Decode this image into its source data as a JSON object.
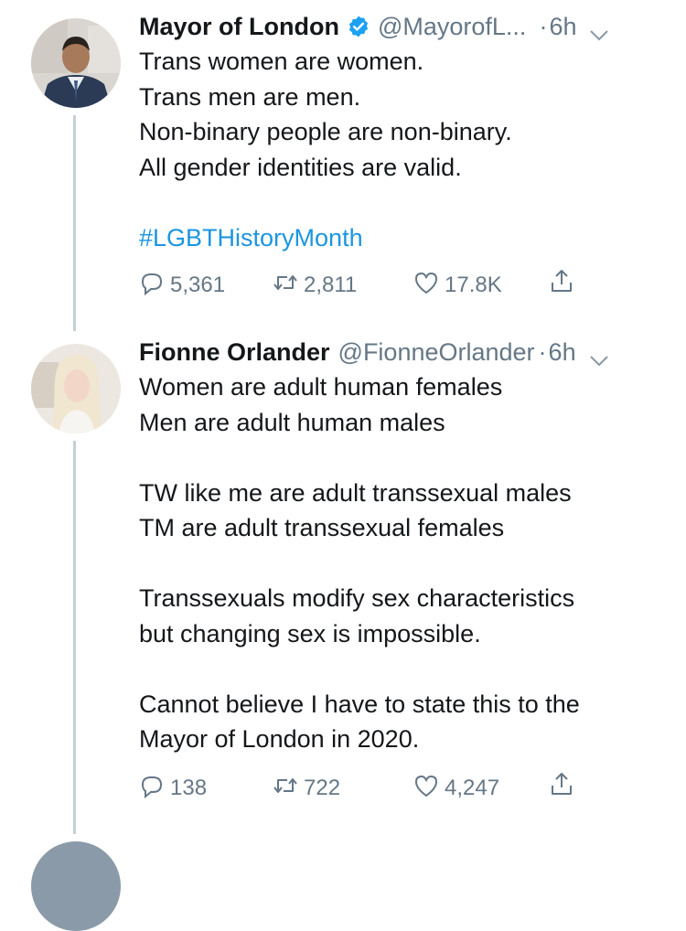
{
  "tweets": [
    {
      "name": "Mayor of London",
      "verified": true,
      "handle": "@MayorofL...",
      "dot": "·",
      "time": "6h",
      "lines": [
        "Trans women are women.",
        "Trans men are men.",
        "Non-binary people are non-binary.",
        "All gender identities are valid.",
        "",
        "#LGBTHistoryMonth"
      ],
      "replies": "5,361",
      "retweets": "2,811",
      "likes": "17.8K"
    },
    {
      "name": "Fionne Orlander",
      "verified": false,
      "handle": "@FionneOrlander",
      "dot": "·",
      "time": "6h",
      "lines": [
        "Women are adult human females",
        "Men are adult human males",
        "",
        "TW like me are adult transsexual males",
        "TM are adult transsexual females",
        "",
        "Transsexuals modify sex characteristics",
        "but changing sex is impossible.",
        "",
        "Cannot believe I have to state this to the",
        "Mayor of London in 2020."
      ],
      "replies": "138",
      "retweets": "722",
      "likes": "4,247"
    }
  ],
  "colors": {
    "text": "#14171a",
    "muted": "#657786",
    "link": "#1b95e0",
    "verified": "#1da1f2",
    "thread": "#c4cfd6"
  },
  "icons": [
    "verified-badge-icon",
    "chevron-down-icon",
    "reply-icon",
    "retweet-icon",
    "like-icon",
    "share-icon"
  ]
}
